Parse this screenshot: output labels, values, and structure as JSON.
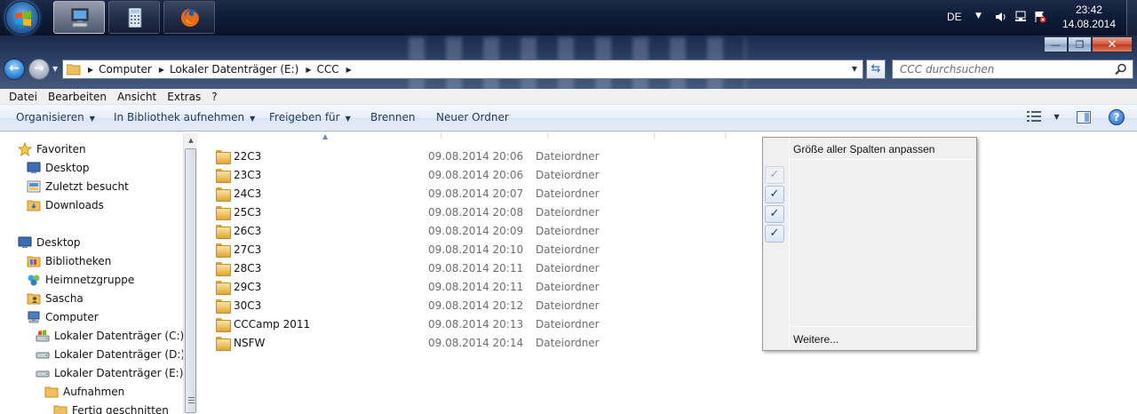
{
  "taskbar": {
    "start_icon": "windows-logo",
    "items": [
      {
        "name": "explorer",
        "icon": "computer-icon",
        "active": true
      },
      {
        "name": "calculator",
        "icon": "calculator-icon",
        "active": false
      },
      {
        "name": "firefox",
        "icon": "firefox-icon",
        "active": false
      }
    ],
    "tray": {
      "language": "DE",
      "icons": [
        "volume-icon",
        "network-icon",
        "action-center-icon"
      ],
      "time": "23:42",
      "date": "14.08.2014"
    }
  },
  "window": {
    "controls": {
      "minimize": "—",
      "maximize": "❐",
      "close": "✕"
    }
  },
  "address": {
    "crumbs": [
      "Computer",
      "Lokaler Datenträger (E:)",
      "CCC"
    ],
    "search_placeholder": "CCC durchsuchen"
  },
  "menu": [
    "Datei",
    "Bearbeiten",
    "Ansicht",
    "Extras",
    "?"
  ],
  "commands": {
    "organize": "Organisieren",
    "include_library": "In Bibliothek aufnehmen",
    "share": "Freigeben für",
    "burn": "Brennen",
    "new_folder": "Neuer Ordner"
  },
  "nav": {
    "items": [
      {
        "label": "Favoriten",
        "icon": "star-icon",
        "level": 0
      },
      {
        "label": "Desktop",
        "icon": "desktop-icon",
        "level": 1
      },
      {
        "label": "Zuletzt besucht",
        "icon": "recent-places-icon",
        "level": 1
      },
      {
        "label": "Downloads",
        "icon": "downloads-folder-icon",
        "level": 1
      },
      {
        "label": "Desktop",
        "icon": "desktop-icon",
        "level": 0
      },
      {
        "label": "Bibliotheken",
        "icon": "libraries-icon",
        "level": 1
      },
      {
        "label": "Heimnetzgruppe",
        "icon": "homegroup-icon",
        "level": 1
      },
      {
        "label": "Sascha",
        "icon": "user-folder-icon",
        "level": 1
      },
      {
        "label": "Computer",
        "icon": "computer-icon",
        "level": 1
      },
      {
        "label": "Lokaler Datenträger (C:)",
        "icon": "system-drive-icon",
        "level": 2
      },
      {
        "label": "Lokaler Datenträger (D:)",
        "icon": "drive-icon",
        "level": 2
      },
      {
        "label": "Lokaler Datenträger (E:)",
        "icon": "drive-icon",
        "level": 2
      },
      {
        "label": "Aufnahmen",
        "icon": "folder-icon",
        "level": 3
      },
      {
        "label": "Fertig geschnitten",
        "icon": "folder-icon",
        "level": 4
      }
    ]
  },
  "files": [
    {
      "name": "22C3",
      "date": "09.08.2014 20:06",
      "type": "Dateiordner"
    },
    {
      "name": "23C3",
      "date": "09.08.2014 20:06",
      "type": "Dateiordner"
    },
    {
      "name": "24C3",
      "date": "09.08.2014 20:07",
      "type": "Dateiordner"
    },
    {
      "name": "25C3",
      "date": "09.08.2014 20:08",
      "type": "Dateiordner"
    },
    {
      "name": "26C3",
      "date": "09.08.2014 20:09",
      "type": "Dateiordner"
    },
    {
      "name": "27C3",
      "date": "09.08.2014 20:10",
      "type": "Dateiordner"
    },
    {
      "name": "28C3",
      "date": "09.08.2014 20:11",
      "type": "Dateiordner"
    },
    {
      "name": "29C3",
      "date": "09.08.2014 20:11",
      "type": "Dateiordner"
    },
    {
      "name": "30C3",
      "date": "09.08.2014 20:12",
      "type": "Dateiordner"
    },
    {
      "name": "CCCamp 2011",
      "date": "09.08.2014 20:13",
      "type": "Dateiordner"
    },
    {
      "name": "NSFW",
      "date": "09.08.2014 20:14",
      "type": "Dateiordner"
    }
  ],
  "context_menu": {
    "fit_all": "Größe aller Spalten anpassen",
    "more": "Weitere...",
    "checks": [
      {
        "checked": true,
        "disabled": true
      },
      {
        "checked": true,
        "disabled": false
      },
      {
        "checked": true,
        "disabled": false
      },
      {
        "checked": true,
        "disabled": false
      }
    ]
  },
  "colors": {
    "taskbar": "#0d1a35",
    "accent": "#1e395b",
    "folder": "#eec05c",
    "muted_text": "#6d6d6d"
  }
}
